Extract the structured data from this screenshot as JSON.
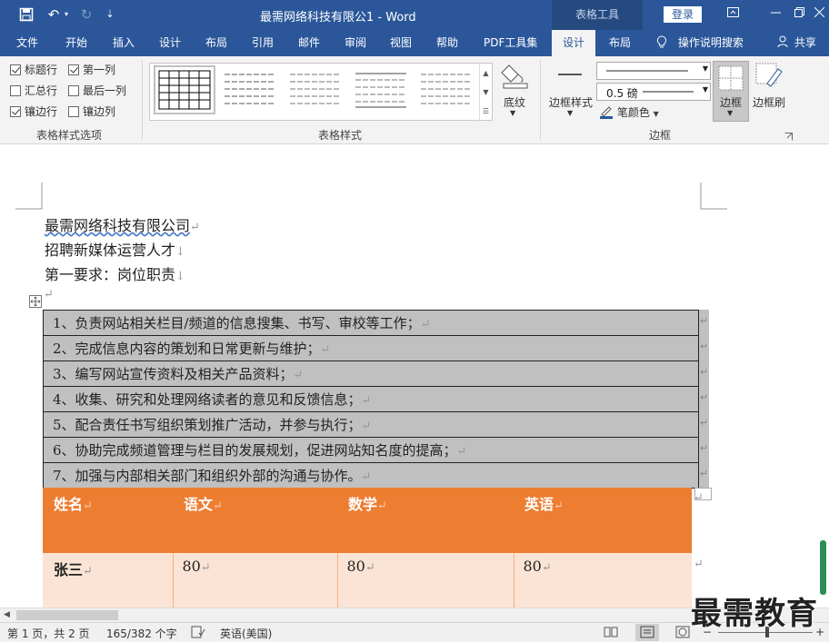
{
  "titlebar": {
    "doc_title": "最需网络科技有限公1  -  Word",
    "context_tab": "表格工具",
    "login": "登录",
    "qa_undo": "↶",
    "qa_redo": "↻",
    "qa_custom": "⇣"
  },
  "tabs": [
    "文件",
    "开始",
    "插入",
    "设计",
    "布局",
    "引用",
    "邮件",
    "审阅",
    "视图",
    "帮助",
    "PDF工具集",
    "设计",
    "布局"
  ],
  "active_tab": "设计",
  "tell_me": "操作说明搜索",
  "share": "共享",
  "ribbon": {
    "style_options": {
      "header_row": "标题行",
      "first_column": "第一列",
      "total_row": "汇总行",
      "last_column": "最后一列",
      "banded_rows": "镶边行",
      "banded_columns": "镶边列",
      "group_label": "表格样式选项"
    },
    "checks": {
      "header_row": true,
      "first_column": true,
      "total_row": false,
      "last_column": false,
      "banded_rows": true,
      "banded_columns": false
    },
    "table_styles_label": "表格样式",
    "shading": "底纹",
    "border_styles": "边框样式",
    "line_weight": "0.5 磅",
    "pen_color": "笔颜色",
    "borders": "边框",
    "border_painter": "边框刷",
    "borders_group": "边框"
  },
  "document": {
    "lines": [
      "最需网络科技有限公司",
      "招聘新媒体运营人才",
      "第一要求：岗位职责"
    ],
    "duties": [
      "1、负责网站相关栏目/频道的信息搜集、书写、审校等工作；",
      "2、完成信息内容的策划和日常更新与维护；",
      "3、编写网站宣传资料及相关产品资料；",
      "4、收集、研究和处理网络读者的意见和反馈信息；",
      "5、配合责任书写组织策划推广活动，并参与执行；",
      "6、协助完成频道管理与栏目的发展规划，促进网站知名度的提高；",
      "7、加强与内部相关部门和组织外部的沟通与协作。"
    ],
    "score_headers": [
      "姓名",
      "语文",
      "数学",
      "英语"
    ],
    "score_rows": [
      [
        "张三",
        "80",
        "80",
        "80"
      ]
    ],
    "para_mark": "↵",
    "line_break": "↓"
  },
  "status": {
    "page": "第 1 页，共 2 页",
    "words": "165/382 个字",
    "language": "英语(美国)"
  },
  "watermark": "最需教育",
  "colors": {
    "brand": "#2b579a",
    "header_fill": "#ed7d31",
    "band_fill": "#fbe4d5",
    "gray_fill": "#c0c0c0"
  }
}
